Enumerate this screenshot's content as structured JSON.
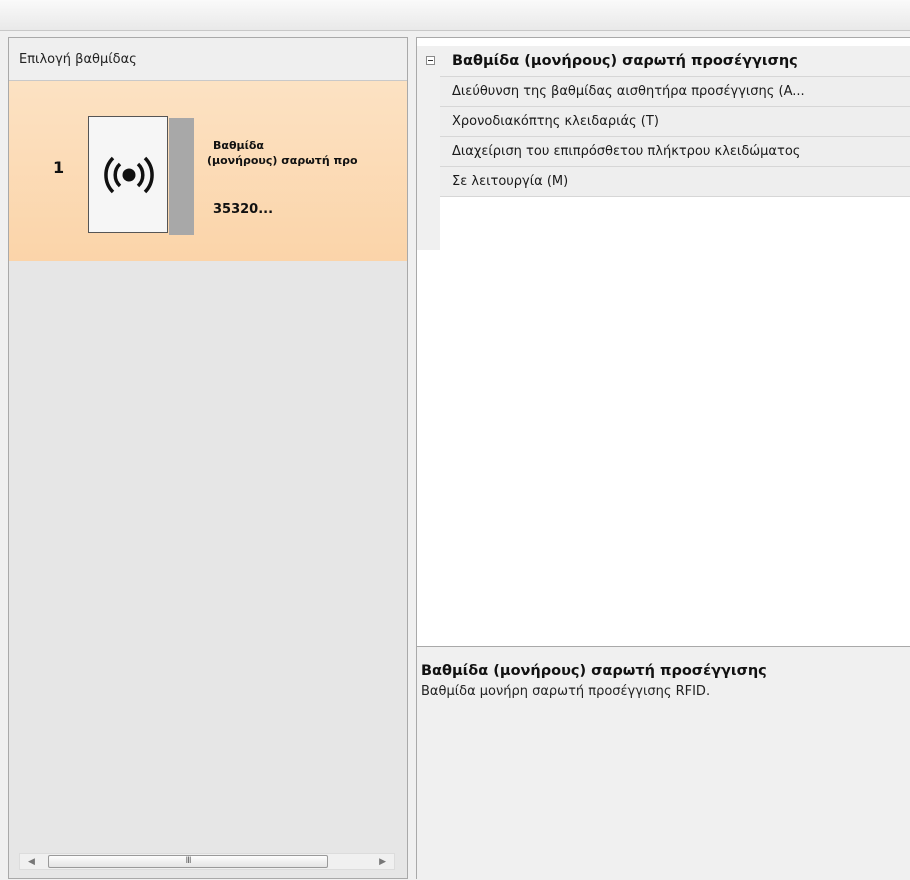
{
  "left_panel": {
    "header": "Επιλογή βαθμίδας",
    "modules": [
      {
        "number": "1",
        "name_line1": "Βαθμίδα",
        "name_line2": "(μονήρους) σαρωτή προ",
        "code": "35320...",
        "icon": "rfid-signal-icon"
      }
    ],
    "scrollbar": {
      "thumb_grip": "III"
    }
  },
  "properties": {
    "category": "Βαθμίδα (μονήρους) σαρωτή προσέγγισης",
    "rows": [
      "Διεύθυνση της βαθμίδας αισθητήρα προσέγγισης (A...",
      "Χρονοδιακόπτης κλειδαριάς (T)",
      "Διαχείριση του επιπρόσθετου πλήκτρου κλειδώματος",
      "Σε λειτουργία (M)"
    ]
  },
  "description": {
    "title": "Βαθμίδα (μονήρους) σαρωτή προσέγγισης",
    "text": "Βαθμίδα μονήρη σαρωτή προσέγγισης RFID."
  },
  "colors": {
    "selected_item": "#fbd9b1",
    "panel_bg": "#e6e6e6",
    "property_row": "#eeeeee"
  }
}
